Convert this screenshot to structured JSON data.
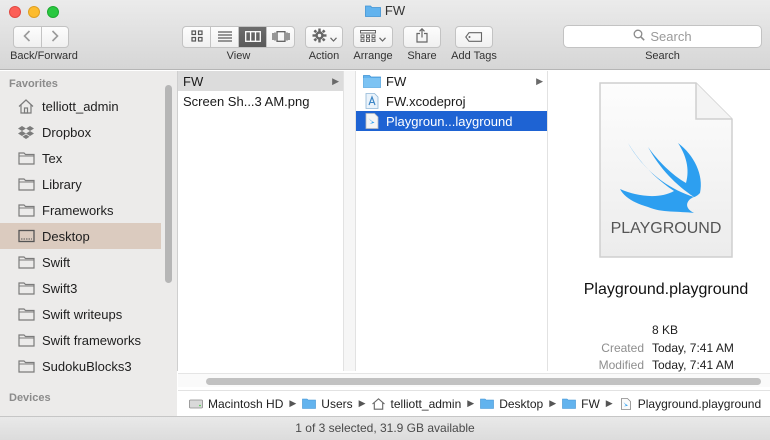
{
  "window": {
    "title": "FW"
  },
  "toolbar": {
    "nav_label": "Back/Forward",
    "view_label": "View",
    "action_label": "Action",
    "arrange_label": "Arrange",
    "share_label": "Share",
    "add_tags_label": "Add Tags",
    "search_placeholder": "Search",
    "search_label": "Search",
    "active_view": "column"
  },
  "sidebar": {
    "favorites_heading": "Favorites",
    "devices_heading": "Devices",
    "items": [
      {
        "label": "telliott_admin",
        "icon": "home-icon"
      },
      {
        "label": "Dropbox",
        "icon": "dropbox-icon"
      },
      {
        "label": "Tex",
        "icon": "folder-icon"
      },
      {
        "label": "Library",
        "icon": "folder-icon"
      },
      {
        "label": "Frameworks",
        "icon": "folder-icon"
      },
      {
        "label": "Desktop",
        "icon": "desktop-icon",
        "selected": true
      },
      {
        "label": "Swift",
        "icon": "folder-icon"
      },
      {
        "label": "Swift3",
        "icon": "folder-icon"
      },
      {
        "label": "Swift writeups",
        "icon": "folder-icon"
      },
      {
        "label": "Swift frameworks",
        "icon": "folder-icon"
      },
      {
        "label": "SudokuBlocks3",
        "icon": "folder-icon"
      }
    ]
  },
  "columns": {
    "col1": [
      {
        "label": "FW",
        "has_children": true,
        "state": "selected-inactive"
      },
      {
        "label": "Screen Sh...3 AM.png",
        "has_children": false
      }
    ],
    "col2": [
      {
        "label": "FW",
        "icon": "folder-icon",
        "has_children": true
      },
      {
        "label": "FW.xcodeproj",
        "icon": "xcodeproj-icon",
        "has_children": false
      },
      {
        "label": "Playgroun...layground",
        "icon": "playground-file-icon",
        "has_children": false,
        "state": "selected"
      }
    ]
  },
  "preview": {
    "icon_caption": "PLAYGROUND",
    "name": "Playground.playground",
    "size": "8 KB",
    "created_label": "Created",
    "created_value": "Today, 7:41 AM",
    "modified_label": "Modified",
    "modified_value": "Today, 7:41 AM",
    "accent_color": "#2d9ff0"
  },
  "pathbar": [
    {
      "label": "Macintosh HD",
      "icon": "hard-drive-icon"
    },
    {
      "label": "Users",
      "icon": "folder-icon"
    },
    {
      "label": "telliott_admin",
      "icon": "home-icon"
    },
    {
      "label": "Desktop",
      "icon": "folder-icon"
    },
    {
      "label": "FW",
      "icon": "folder-icon"
    },
    {
      "label": "Playground.playground",
      "icon": "file-icon"
    }
  ],
  "status": {
    "text": "1 of 3 selected, 31.9 GB available"
  }
}
